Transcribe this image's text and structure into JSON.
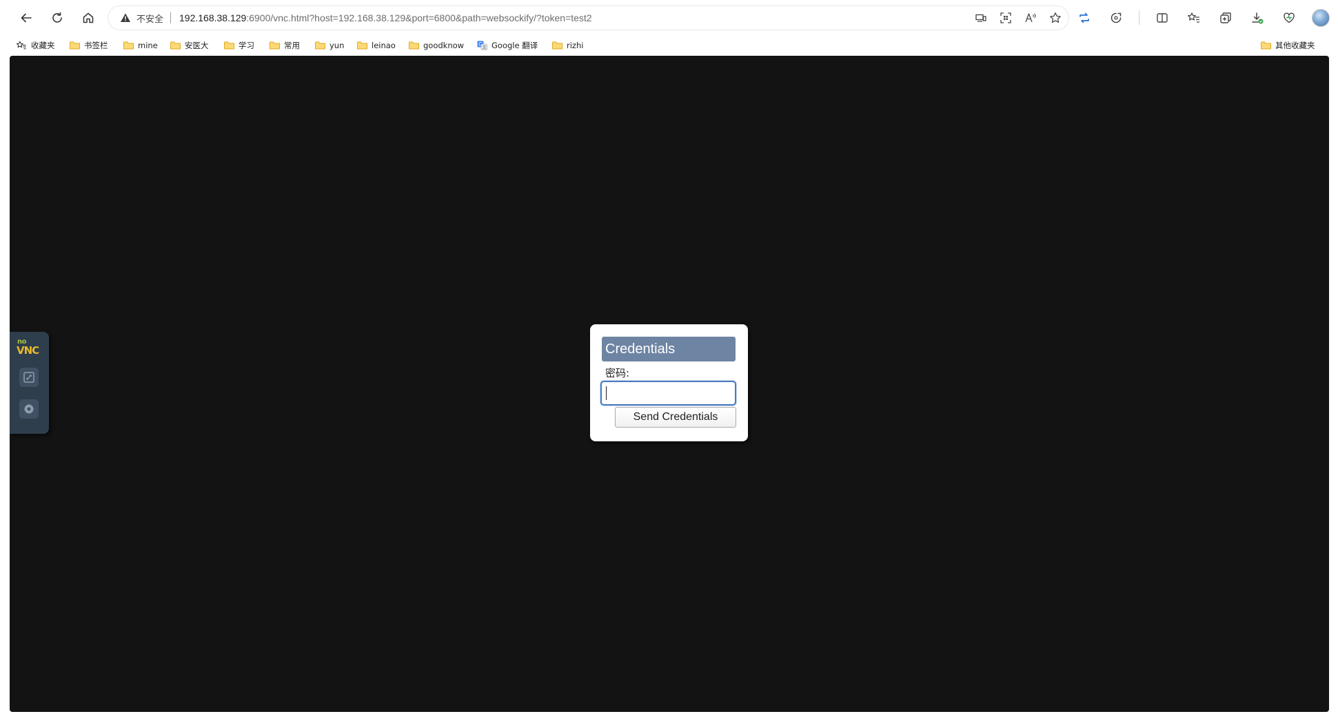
{
  "browser": {
    "address": {
      "security_label": "不安全",
      "host": "192.168.38.129",
      "rest": ":6900/vnc.html?host=192.168.38.129&port=6800&path=websockify/?token=test2"
    },
    "nav": [
      "back-icon",
      "refresh-icon",
      "home-icon"
    ],
    "address_icons": [
      "devices-icon",
      "qr-icon",
      "read-aloud-icon",
      "star-icon"
    ],
    "toolbar_icons": [
      "sync-icon",
      "extensions-icon",
      "split-screen-icon",
      "favorites-icon",
      "collections-icon",
      "downloads-icon",
      "heart-icon",
      "profile-icon"
    ]
  },
  "bookmarks": {
    "favorites_label": "收藏夹",
    "items": [
      {
        "label": "书签栏",
        "icon": "folder-icon"
      },
      {
        "label": "mine",
        "icon": "folder-icon"
      },
      {
        "label": "安医大",
        "icon": "folder-icon"
      },
      {
        "label": "学习",
        "icon": "folder-icon"
      },
      {
        "label": "常用",
        "icon": "folder-icon"
      },
      {
        "label": "yun",
        "icon": "folder-icon"
      },
      {
        "label": "leinao",
        "icon": "folder-icon"
      },
      {
        "label": "goodknow",
        "icon": "folder-icon"
      },
      {
        "label": "Google 翻译",
        "icon": "google-translate-icon"
      },
      {
        "label": "rizhi",
        "icon": "folder-icon"
      }
    ],
    "other_label": "其他收藏夹"
  },
  "vnc": {
    "logo_top": "no",
    "logo_bottom": "VNC",
    "controls": [
      "fullscreen-icon",
      "settings-icon"
    ]
  },
  "dialog": {
    "title": "Credentials",
    "password_label": "密码:",
    "password_value": "",
    "send_button": "Send Credentials"
  },
  "colors": {
    "viewport_bg": "#131313",
    "control_bar": "#2e3e4d",
    "dialog_header": "#6e84a3",
    "logo_no": "#a8c43a",
    "logo_vnc": "#e9b82b",
    "folder": "#f5c542"
  }
}
